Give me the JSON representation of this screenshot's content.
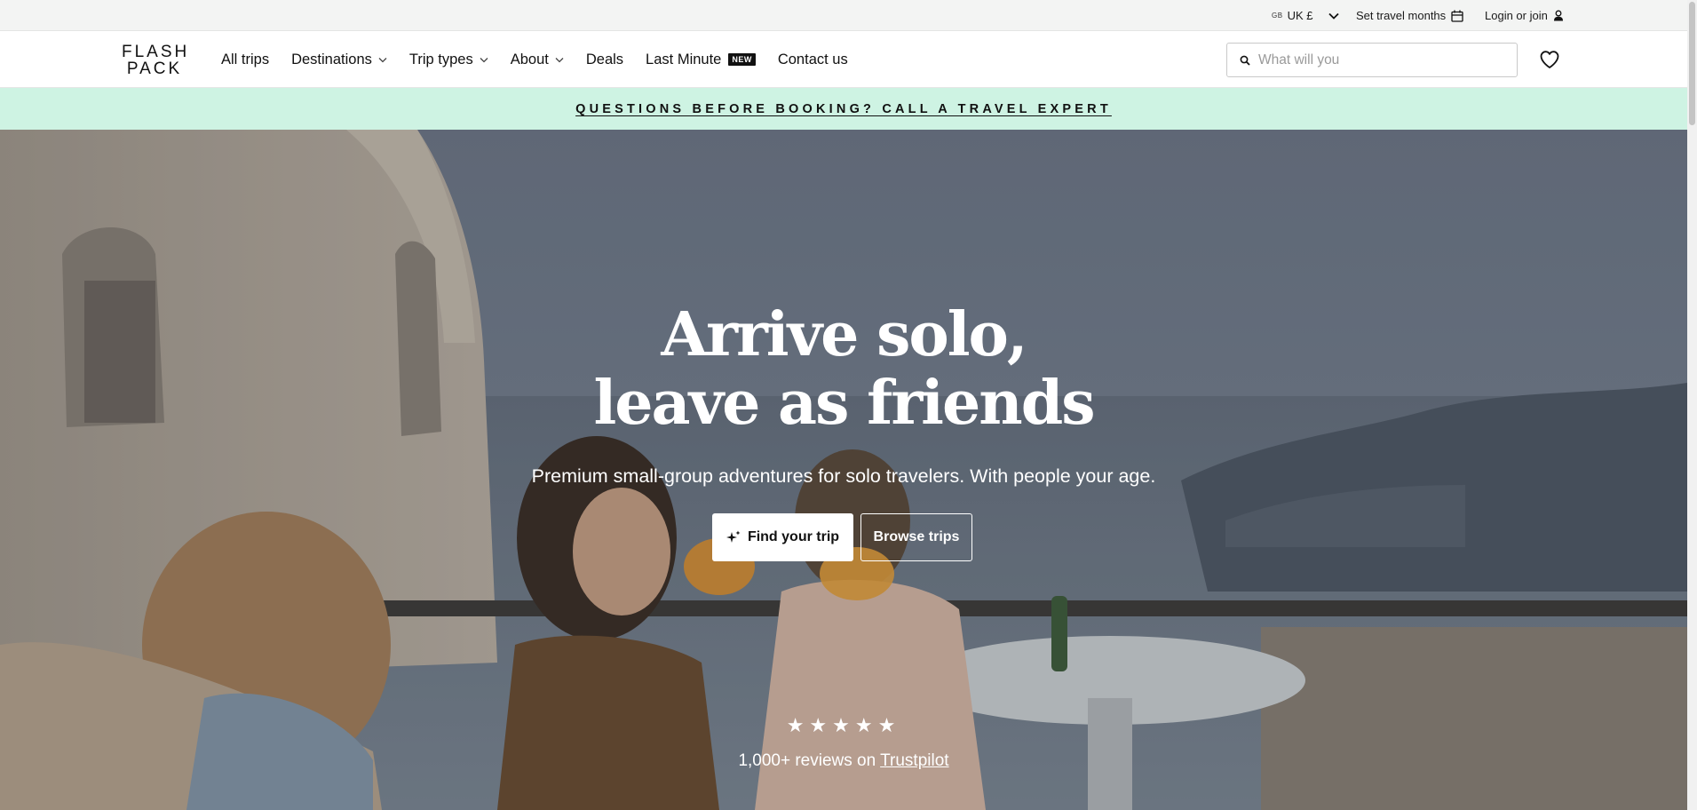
{
  "utility": {
    "locale_flag": "GB",
    "locale_label": "UK £",
    "travel_months_label": "Set travel months",
    "login_label": "Login or join"
  },
  "nav": {
    "logo_line1": "FLASH",
    "logo_line2": "PACK",
    "links": [
      {
        "label": "All trips"
      },
      {
        "label": "Destinations"
      },
      {
        "label": "Trip types"
      },
      {
        "label": "About"
      },
      {
        "label": "Deals"
      },
      {
        "label": "Last Minute",
        "badge": "NEW"
      },
      {
        "label": "Contact us"
      }
    ],
    "search_placeholder": "What will you"
  },
  "promo": {
    "text": "QUESTIONS BEFORE BOOKING? CALL A TRAVEL EXPERT"
  },
  "hero": {
    "title_line1": "Arrive solo,",
    "title_line2": "leave as friends",
    "subtitle": "Premium small-group adventures for solo travelers. With people your age.",
    "primary_button": "Find your trip",
    "secondary_button": "Browse trips",
    "stars": "★★★★★",
    "rating": 5,
    "reviews_prefix": "1,000+ reviews on",
    "reviews_link": "Trustpilot"
  },
  "colors": {
    "promo_bg": "#cef3e3",
    "utility_bg": "#f3f4f3",
    "text": "#111111"
  }
}
